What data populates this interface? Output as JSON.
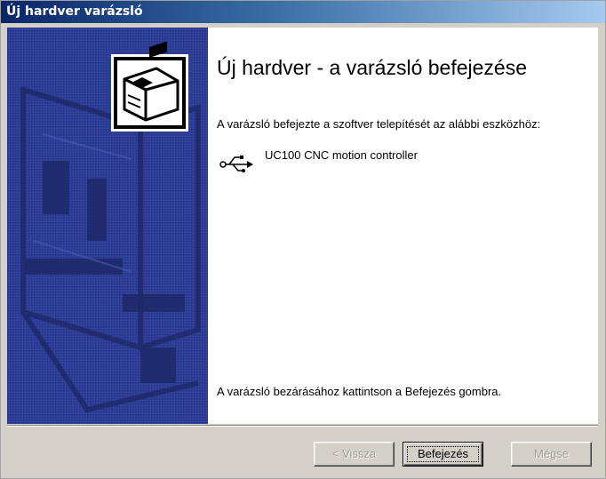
{
  "window": {
    "title": "Új hardver varázsló"
  },
  "content": {
    "heading": "Új hardver - a varázsló befejezése",
    "description": "A varázsló befejezte a szoftver telepítését az alábbi eszközhöz:",
    "device": {
      "name": "UC100 CNC motion controller",
      "icon": "usb-icon"
    },
    "finish_hint": "A varázsló bezárásához kattintson a Befejezés gombra."
  },
  "buttons": {
    "back": {
      "label": "< Vissza",
      "enabled": false
    },
    "finish": {
      "label": "Befejezés",
      "enabled": true,
      "default": true
    },
    "cancel": {
      "label": "Mégse",
      "enabled": false
    }
  },
  "colors": {
    "title_gradient_start": "#0a246a",
    "title_gradient_end": "#a6caf0",
    "side_panel": "#2b3a8f",
    "face": "#d4d0c8"
  }
}
